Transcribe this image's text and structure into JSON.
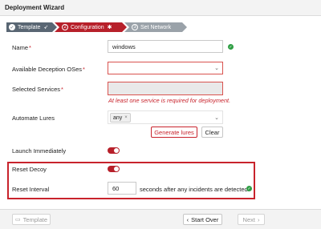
{
  "window": {
    "title": "Deployment Wizard"
  },
  "steps": [
    {
      "number": "✓",
      "label": "Template",
      "icon": "rocket-icon"
    },
    {
      "number": "2",
      "label": "Configuration",
      "icon": "settings-icon"
    },
    {
      "number": "3",
      "label": "Set Network",
      "icon": "network-icon"
    }
  ],
  "form": {
    "name": {
      "label": "Name",
      "required": "*",
      "value": "windows"
    },
    "oses": {
      "label": "Available Deception OSes",
      "required": "*"
    },
    "services": {
      "label": "Selected Services",
      "required": "*",
      "error": "At least one service is required for deployment."
    },
    "lures": {
      "label": "Automate Lures",
      "tag": "any",
      "tag_remove": "×",
      "generate_label": "Generate lures",
      "clear_label": "Clear"
    },
    "launch": {
      "label": "Launch Immediately",
      "on": true
    },
    "reset_decoy": {
      "label": "Reset Decoy",
      "on": true
    },
    "reset_interval": {
      "label": "Reset Interval",
      "value": "60",
      "suffix": "seconds after any incidents are detected."
    }
  },
  "footer": {
    "template_label": "Template",
    "start_over_label": "Start Over",
    "next_label": "Next"
  },
  "colors": {
    "accent": "#b7202a",
    "step_done": "#596673",
    "step_todo": "#9aa2a9",
    "success": "#2f9e44"
  }
}
